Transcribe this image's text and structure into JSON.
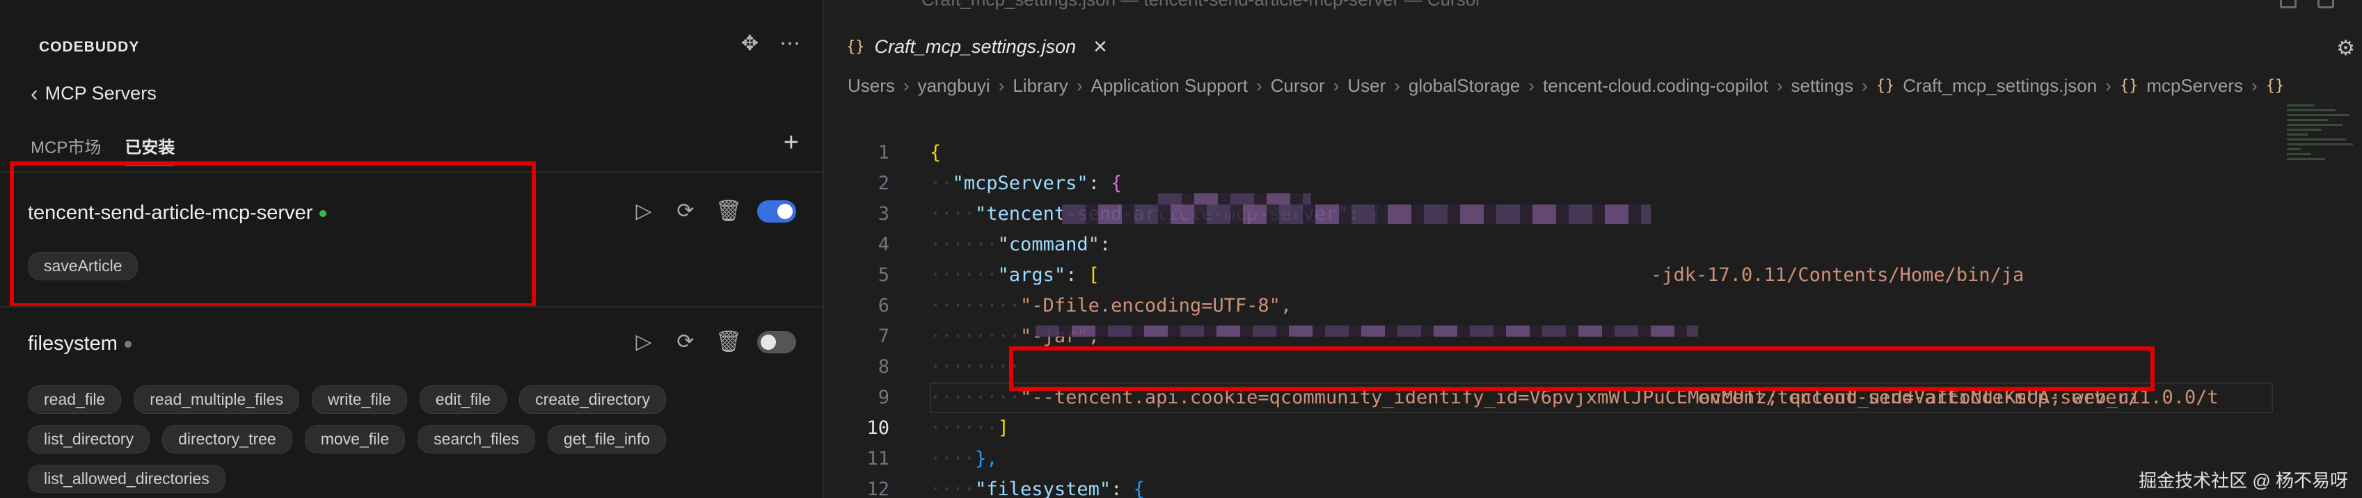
{
  "window": {
    "title": "Craft_mcp_settings.json — tencent-send-article-mcp-server — Cursor"
  },
  "sidebar": {
    "brand": "CODEBUDDY",
    "back_label": "MCP Servers",
    "tabs": [
      {
        "label": "MCP市场",
        "active": false
      },
      {
        "label": "已安装",
        "active": true
      }
    ],
    "servers": [
      {
        "name": "tencent-send-article-mcp-server",
        "status_color": "#3fb950",
        "enabled": true,
        "tools": [
          "saveArticle"
        ]
      },
      {
        "name": "filesystem",
        "status_color": "#7a7a7a",
        "enabled": false,
        "tools": [
          "read_file",
          "read_multiple_files",
          "write_file",
          "edit_file",
          "create_directory",
          "list_directory",
          "directory_tree",
          "move_file",
          "search_files",
          "get_file_info",
          "list_allowed_directories"
        ]
      }
    ]
  },
  "editor": {
    "tab_label": "Craft_mcp_settings.json",
    "tab_icon": "{}",
    "breadcrumb": [
      "Users",
      "yangbuyi",
      "Library",
      "Application Support",
      "Cursor",
      "User",
      "globalStorage",
      "tencent-cloud.coding-copilot",
      "settings",
      "Craft_mcp_settings.json",
      "mcpServers",
      "{}"
    ],
    "current_line": 10,
    "lines": {
      "l1": "{",
      "l2_key": "\"mcpServers\"",
      "l3_key": "\"tencent-send-article-mcp-server\"",
      "l4_key": "\"command\"",
      "l4_val": "-jdk-17.0.11/Contents/Home/bin/ja",
      "l5_key": "\"args\"",
      "l6": "\"-Dfile.encoding=UTF-8\",",
      "l7": "\"-jar\",",
      "l8": "encent/tencent-send-article-mcp-server/1.0.0/t",
      "l9": "\"--tencent.api.cookie=qcommunity_identify_id=V6pvjxmWlJPuCEMovMUTz; qcloud_uid=VaIEoNdiKsUA; web_ui",
      "l10": "]",
      "l11": "},",
      "l12_key": "\"filesystem\""
    }
  },
  "watermark": "掘金技术社区 @ 杨不易呀"
}
